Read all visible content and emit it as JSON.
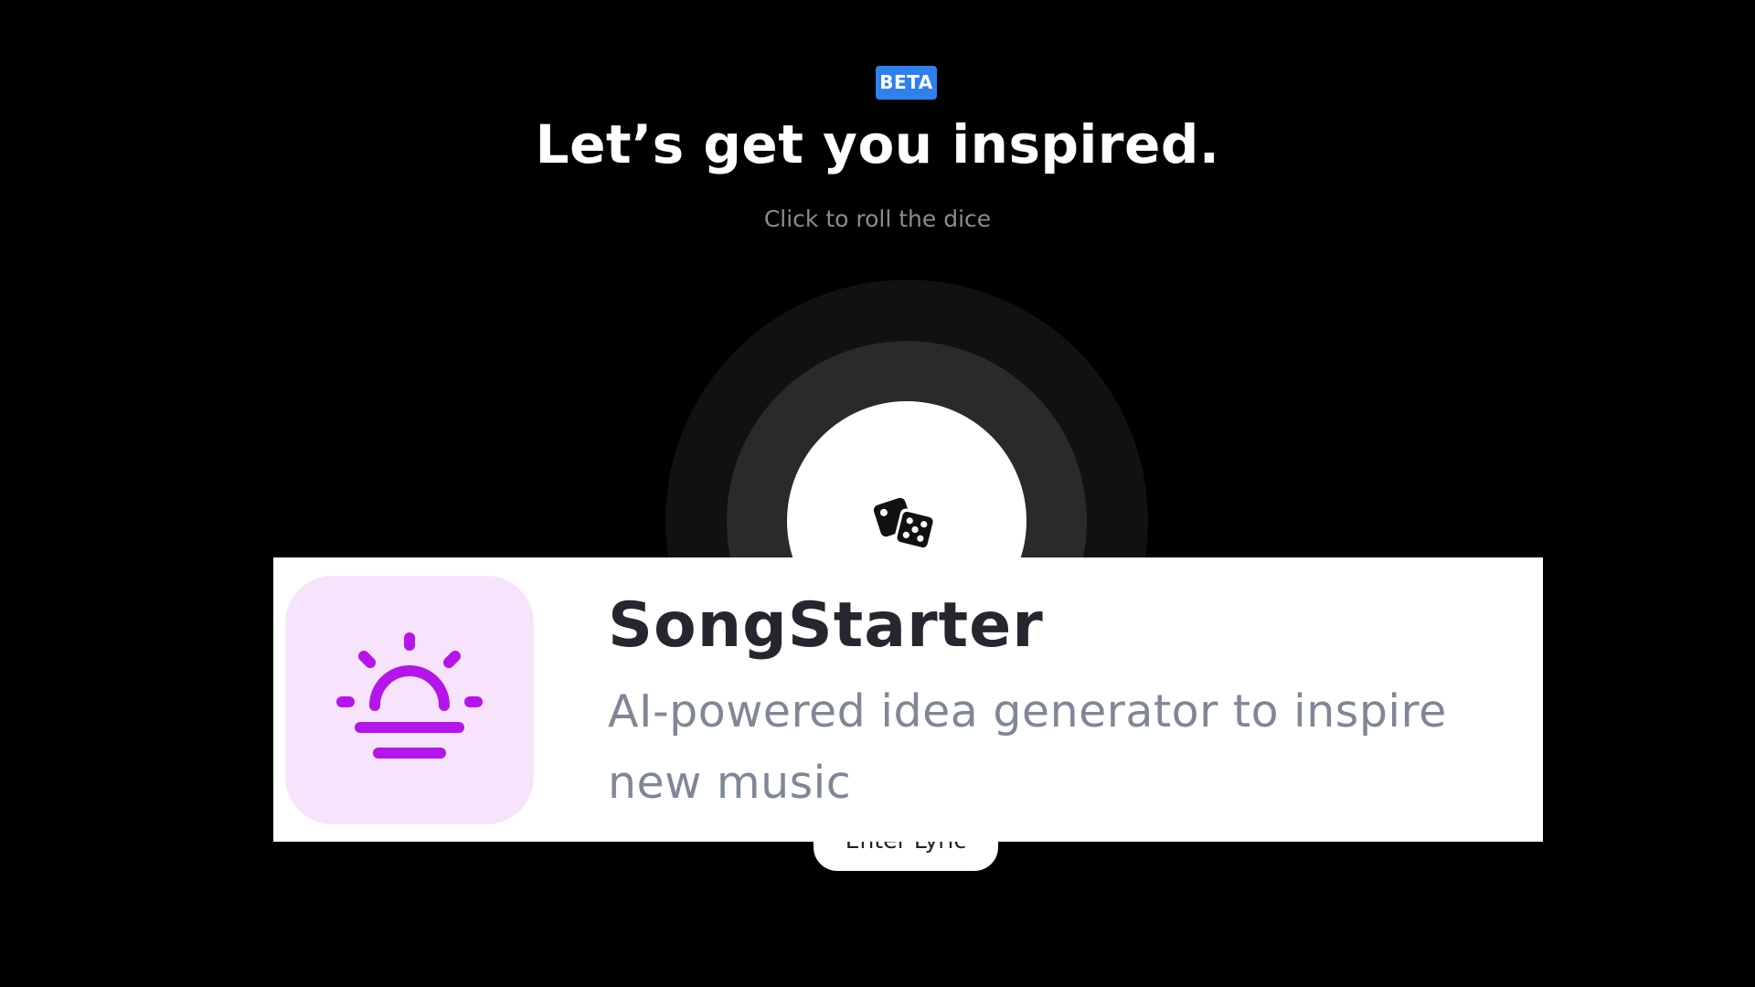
{
  "colors": {
    "background": "#000000",
    "beta_badge": "#2f80ed",
    "app_icon_bg": "#f7e4fc",
    "app_icon_fg": "#b514ea",
    "title_text": "#26262e",
    "desc_text": "#7f8797"
  },
  "header": {
    "badge": "BETA",
    "title": "Let’s get you inspired.",
    "subtitle": "Click to roll the dice"
  },
  "roller": {
    "icon": "dice-icon"
  },
  "lyric_button": {
    "label": "Enter Lyric"
  },
  "banner": {
    "icon": "sunrise-icon",
    "app_name": "SongStarter",
    "description": "AI-powered idea generator to inspire new music"
  }
}
